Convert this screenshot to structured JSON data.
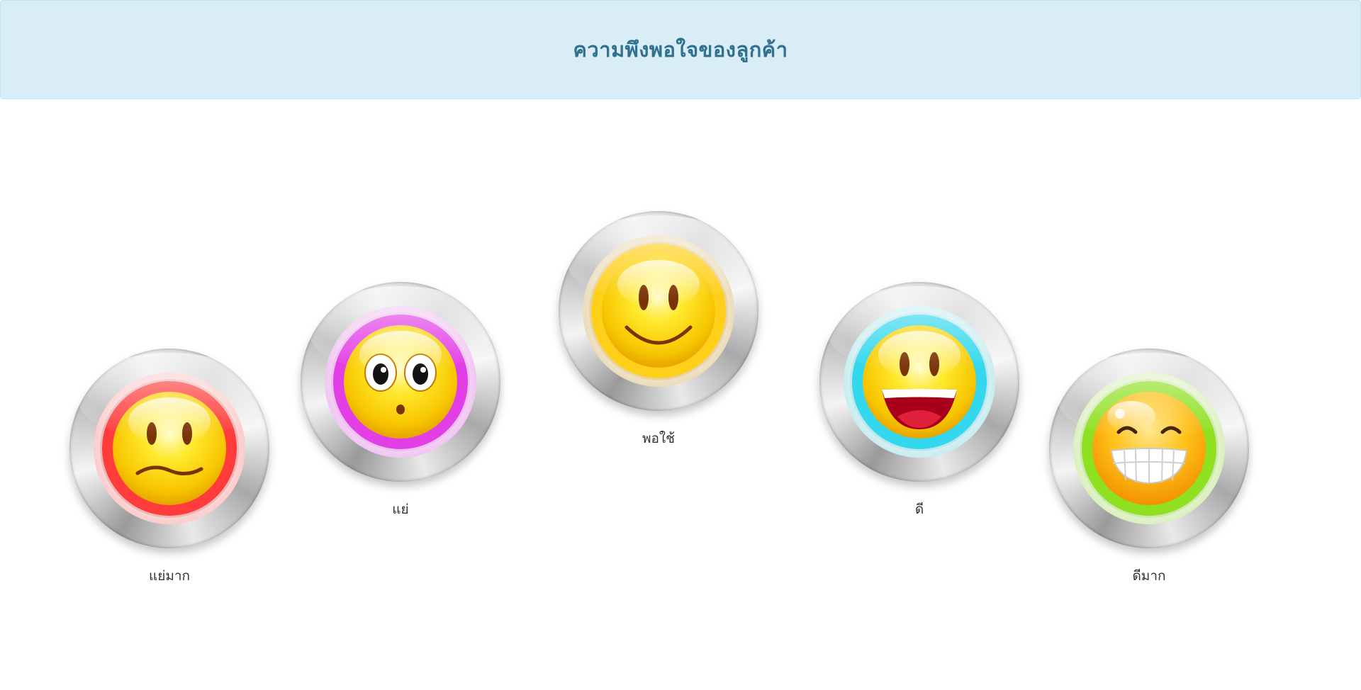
{
  "header": {
    "title": "ความพึงพอใจของลูกค้า"
  },
  "ratings": [
    {
      "label": "แย่มาก",
      "icon": "frown-face-icon",
      "ring_color": "#e00000"
    },
    {
      "label": "แย่",
      "icon": "surprised-face-icon",
      "ring_color": "#d400d8"
    },
    {
      "label": "พอใช้",
      "icon": "smile-face-icon",
      "ring_color": "#e6a800"
    },
    {
      "label": "ดี",
      "icon": "laughing-face-icon",
      "ring_color": "#00c6e0"
    },
    {
      "label": "ดีมาก",
      "icon": "grinning-face-icon",
      "ring_color": "#6fd000"
    }
  ]
}
